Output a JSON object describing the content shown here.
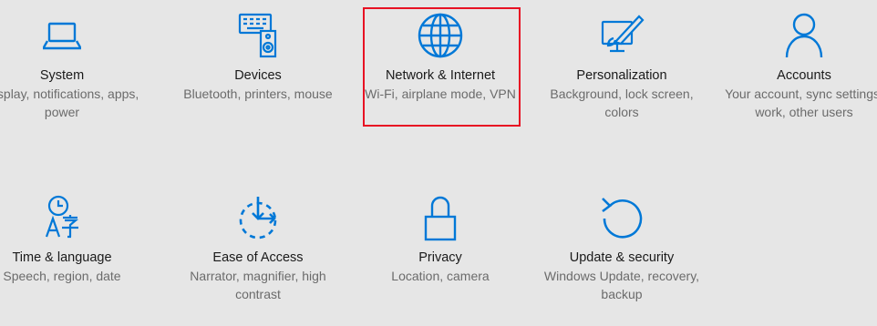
{
  "settings": {
    "accent_color": "#0078d7",
    "highlight_color": "#e81123",
    "tiles": [
      {
        "title": "System",
        "desc": "Display, notifications, apps, power",
        "icon": "laptop-icon"
      },
      {
        "title": "Devices",
        "desc": "Bluetooth, printers, mouse",
        "icon": "devices-icon"
      },
      {
        "title": "Network & Internet",
        "desc": "Wi-Fi, airplane mode, VPN",
        "icon": "globe-icon",
        "selected": true
      },
      {
        "title": "Personalization",
        "desc": "Background, lock screen, colors",
        "icon": "personalization-icon"
      },
      {
        "title": "Accounts",
        "desc": "Your account, sync settings, work, other users",
        "icon": "person-icon"
      },
      {
        "title": "Time & language",
        "desc": "Speech, region, date",
        "icon": "time-language-icon"
      },
      {
        "title": "Ease of Access",
        "desc": "Narrator, magnifier, high contrast",
        "icon": "ease-of-access-icon"
      },
      {
        "title": "Privacy",
        "desc": "Location, camera",
        "icon": "lock-icon"
      },
      {
        "title": "Update & security",
        "desc": "Windows Update, recovery, backup",
        "icon": "update-icon"
      }
    ]
  }
}
